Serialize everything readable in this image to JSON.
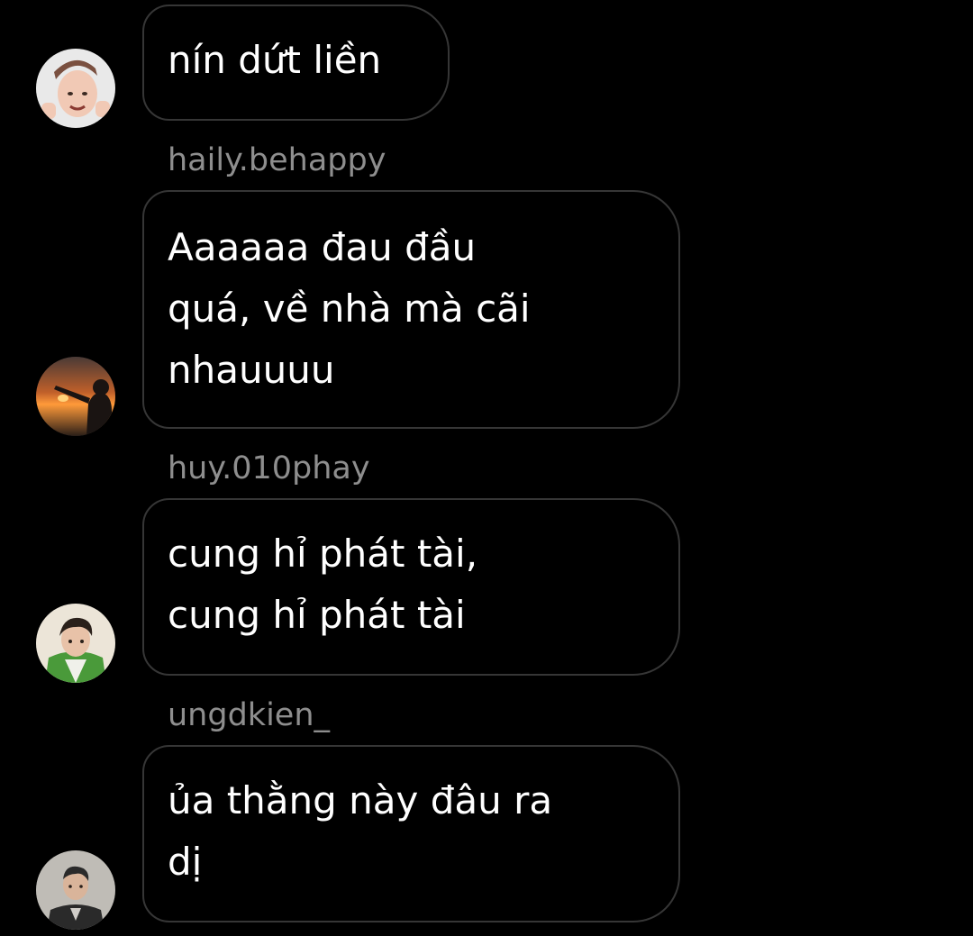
{
  "messages": [
    {
      "username": "",
      "text": "nín dứt liền",
      "avatar": {
        "icon": "user-avatar-photo",
        "colors": [
          "#e9e9e9",
          "#f1c9b5",
          "#7a5040"
        ]
      }
    },
    {
      "username": "haily.behappy",
      "text": "Aaaaaa đau đầu\nquá, về nhà mà cãi\nnhauuuu",
      "avatar": {
        "icon": "user-avatar-photo",
        "colors": [
          "#3a2a26",
          "#ff8a2a",
          "#1a1412"
        ]
      }
    },
    {
      "username": "huy.010phay",
      "text": "cung hỉ phát tài,\ncung hỉ phát tài",
      "avatar": {
        "icon": "user-avatar-photo",
        "colors": [
          "#ece5d8",
          "#4a9a3a",
          "#2a201a"
        ]
      }
    },
    {
      "username": "ungdkien_",
      "text": "ủa thằng này đâu ra\ndị",
      "avatar": {
        "icon": "user-avatar-photo",
        "colors": [
          "#bfbcb6",
          "#2a2a2a",
          "#d9b49a"
        ]
      }
    }
  ],
  "colors": {
    "background": "#000000",
    "bubble_border": "#363636",
    "username": "#8e8e8e",
    "message_text": "#ffffff"
  }
}
